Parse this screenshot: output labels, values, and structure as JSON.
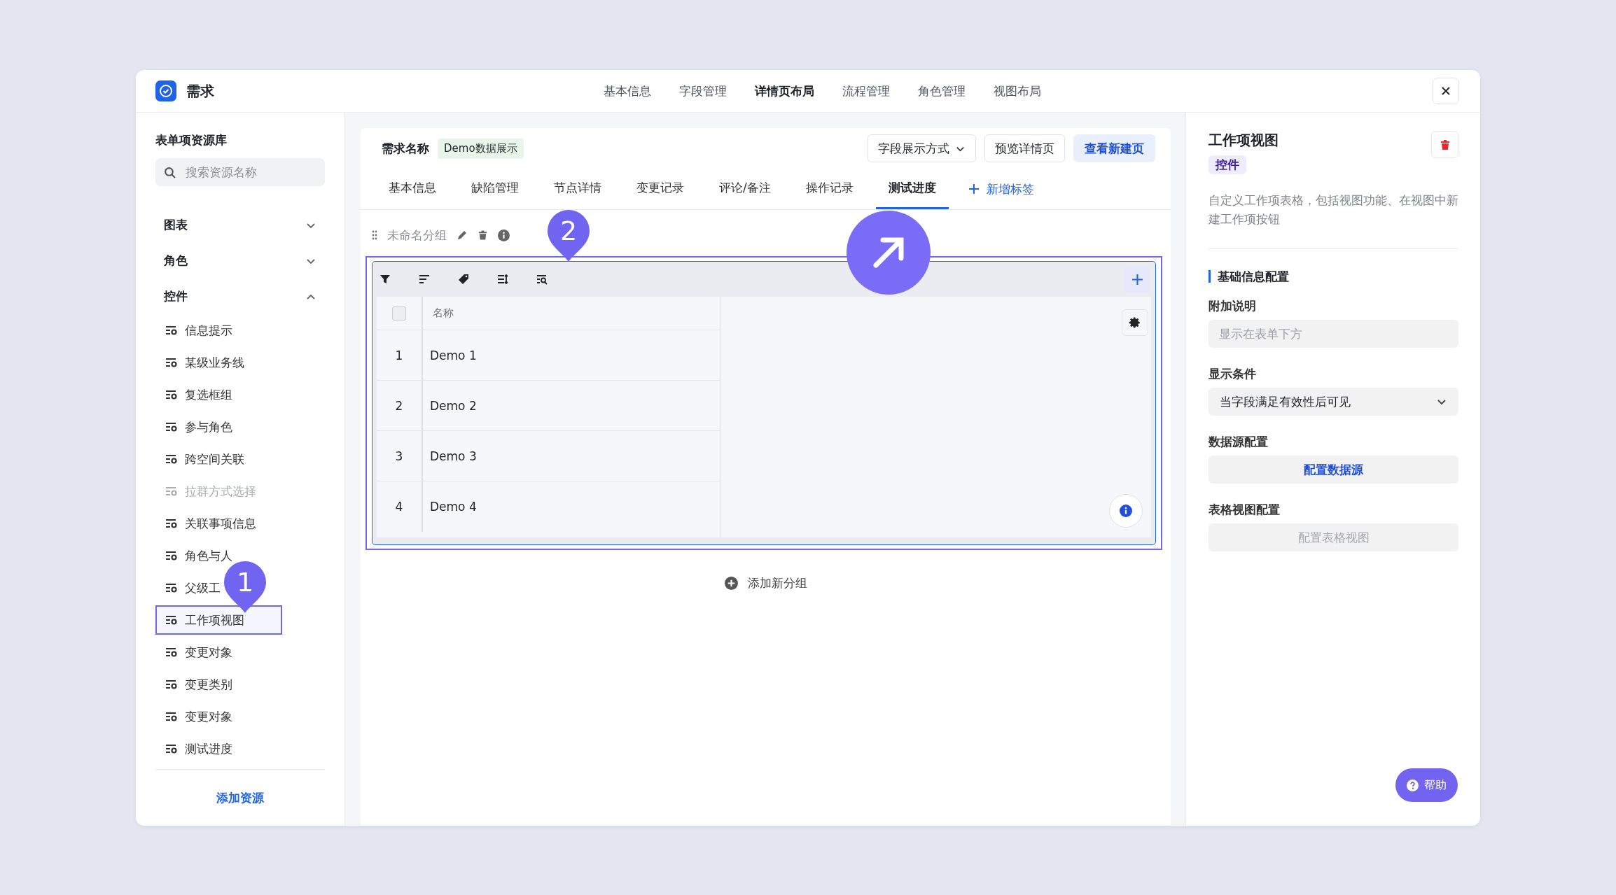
{
  "app": {
    "title": "需求"
  },
  "top_tabs": [
    {
      "label": "基本信息",
      "selected": false
    },
    {
      "label": "字段管理",
      "selected": false
    },
    {
      "label": "详情页布局",
      "selected": true
    },
    {
      "label": "流程管理",
      "selected": false
    },
    {
      "label": "角色管理",
      "selected": false
    },
    {
      "label": "视图布局",
      "selected": false
    }
  ],
  "sidebar": {
    "title": "表单项资源库",
    "search": {
      "placeholder": "搜索资源名称"
    },
    "groups": [
      {
        "label": "图表",
        "expanded": false
      },
      {
        "label": "角色",
        "expanded": false
      },
      {
        "label": "控件",
        "expanded": true,
        "items": [
          {
            "label": "信息提示",
            "disabled": false,
            "selected": false
          },
          {
            "label": "某级业务线",
            "disabled": false,
            "selected": false
          },
          {
            "label": "复选框组",
            "disabled": false,
            "selected": false
          },
          {
            "label": "参与角色",
            "disabled": false,
            "selected": false
          },
          {
            "label": "跨空间关联",
            "disabled": false,
            "selected": false
          },
          {
            "label": "拉群方式选择",
            "disabled": true,
            "selected": false
          },
          {
            "label": "关联事项信息",
            "disabled": false,
            "selected": false
          },
          {
            "label": "角色与人",
            "disabled": false,
            "selected": false
          },
          {
            "label": "父级工",
            "disabled": false,
            "selected": false
          },
          {
            "label": "工作项视图",
            "disabled": false,
            "selected": true
          },
          {
            "label": "变更对象",
            "disabled": false,
            "selected": false
          },
          {
            "label": "变更类别",
            "disabled": false,
            "selected": false
          },
          {
            "label": "变更对象",
            "disabled": false,
            "selected": false
          },
          {
            "label": "测试进度",
            "disabled": false,
            "selected": false
          }
        ]
      }
    ],
    "add_button": "添加资源"
  },
  "editor": {
    "field_name": "需求名称",
    "badge": "Demo数据展示",
    "display_mode": "字段展示方式",
    "preview_button": "预览详情页",
    "new_page_button": "查看新建页",
    "tabs": [
      {
        "label": "基本信息",
        "selected": false
      },
      {
        "label": "缺陷管理",
        "selected": false
      },
      {
        "label": "节点详情",
        "selected": false
      },
      {
        "label": "变更记录",
        "selected": false
      },
      {
        "label": "评论/备注",
        "selected": false
      },
      {
        "label": "操作记录",
        "selected": false
      },
      {
        "label": "测试进度",
        "selected": true
      }
    ],
    "add_tab": "新增标签",
    "group": {
      "title": "未命名分组",
      "table": {
        "select_all": {
          "checked": false
        },
        "columns": [
          "名称"
        ],
        "rows": [
          {
            "index": "1",
            "name": "Demo  1"
          },
          {
            "index": "2",
            "name": "Demo  2"
          },
          {
            "index": "3",
            "name": "Demo  3"
          },
          {
            "index": "4",
            "name": "Demo  4"
          }
        ]
      }
    },
    "add_group": "添加新分组"
  },
  "inspector": {
    "title": "工作项视图",
    "tag": "控件",
    "description": "自定义工作项表格，包括视图功能、在视图中新建工作项按钮",
    "section": "基础信息配置",
    "fields": [
      {
        "kind": "input",
        "label": "附加说明",
        "placeholder": "显示在表单下方"
      },
      {
        "kind": "select",
        "label": "显示条件",
        "value": "当字段满足有效性后可见"
      },
      {
        "kind": "button",
        "label": "数据源配置",
        "button": "配置数据源",
        "disabled": false
      },
      {
        "kind": "button",
        "label": "表格视图配置",
        "button": "配置表格视图",
        "disabled": true
      }
    ]
  },
  "annotations": [
    {
      "kind": "pin",
      "label": "1"
    },
    {
      "kind": "pin",
      "label": "2"
    },
    {
      "kind": "arrow"
    }
  ],
  "help_button": "帮助"
}
